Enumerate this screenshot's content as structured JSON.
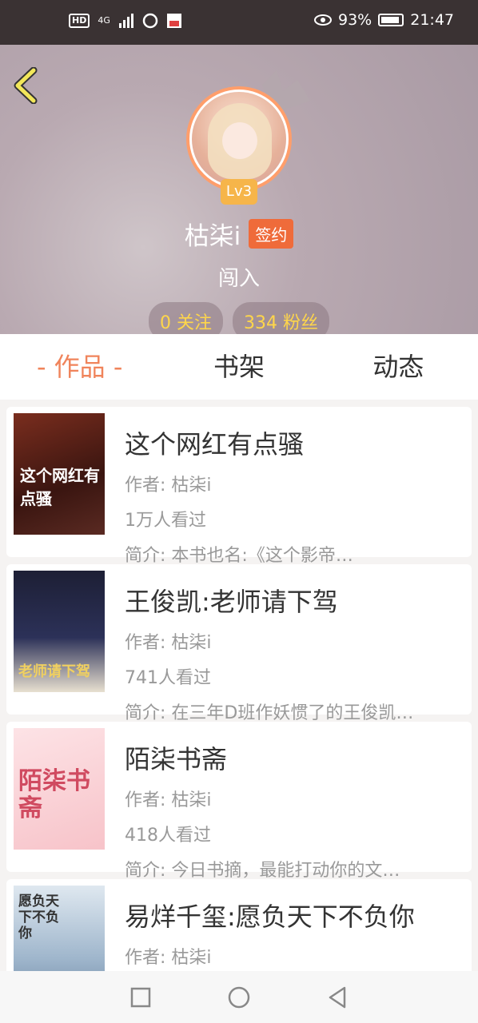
{
  "status_bar": {
    "hd": "HD",
    "network": "4G",
    "battery": "93%",
    "time": "21:47"
  },
  "profile": {
    "level": "Lv3",
    "name": "枯柒i",
    "badge": "签约",
    "bio": "闯入",
    "following": "0 关注",
    "fans": "334 粉丝"
  },
  "tabs": [
    {
      "label": "- 作品 -",
      "active": true
    },
    {
      "label": "书架",
      "active": false
    },
    {
      "label": "动态",
      "active": false
    }
  ],
  "books": [
    {
      "title": "这个网红有点骚",
      "author": "作者: 枯柒i",
      "views": "1万人看过",
      "intro": "简介: 本书也名:《这个影帝…",
      "cover_text": "这个网红有点骚"
    },
    {
      "title": "王俊凯:老师请下驾",
      "author": "作者: 枯柒i",
      "views": "741人看过",
      "intro": "简介: 在三年D班作妖惯了的王俊凯…",
      "cover_text": "老师请下驾"
    },
    {
      "title": "陌柒书斋",
      "author": "作者: 枯柒i",
      "views": "418人看过",
      "intro": "简介: 今日书摘，最能打动你的文…",
      "cover_text": "陌柒书斋"
    },
    {
      "title": "易烊千玺:愿负天下不负你",
      "author": "作者: 枯柒i",
      "views": "",
      "intro": "",
      "cover_text": "愿负天下不负你"
    }
  ]
}
